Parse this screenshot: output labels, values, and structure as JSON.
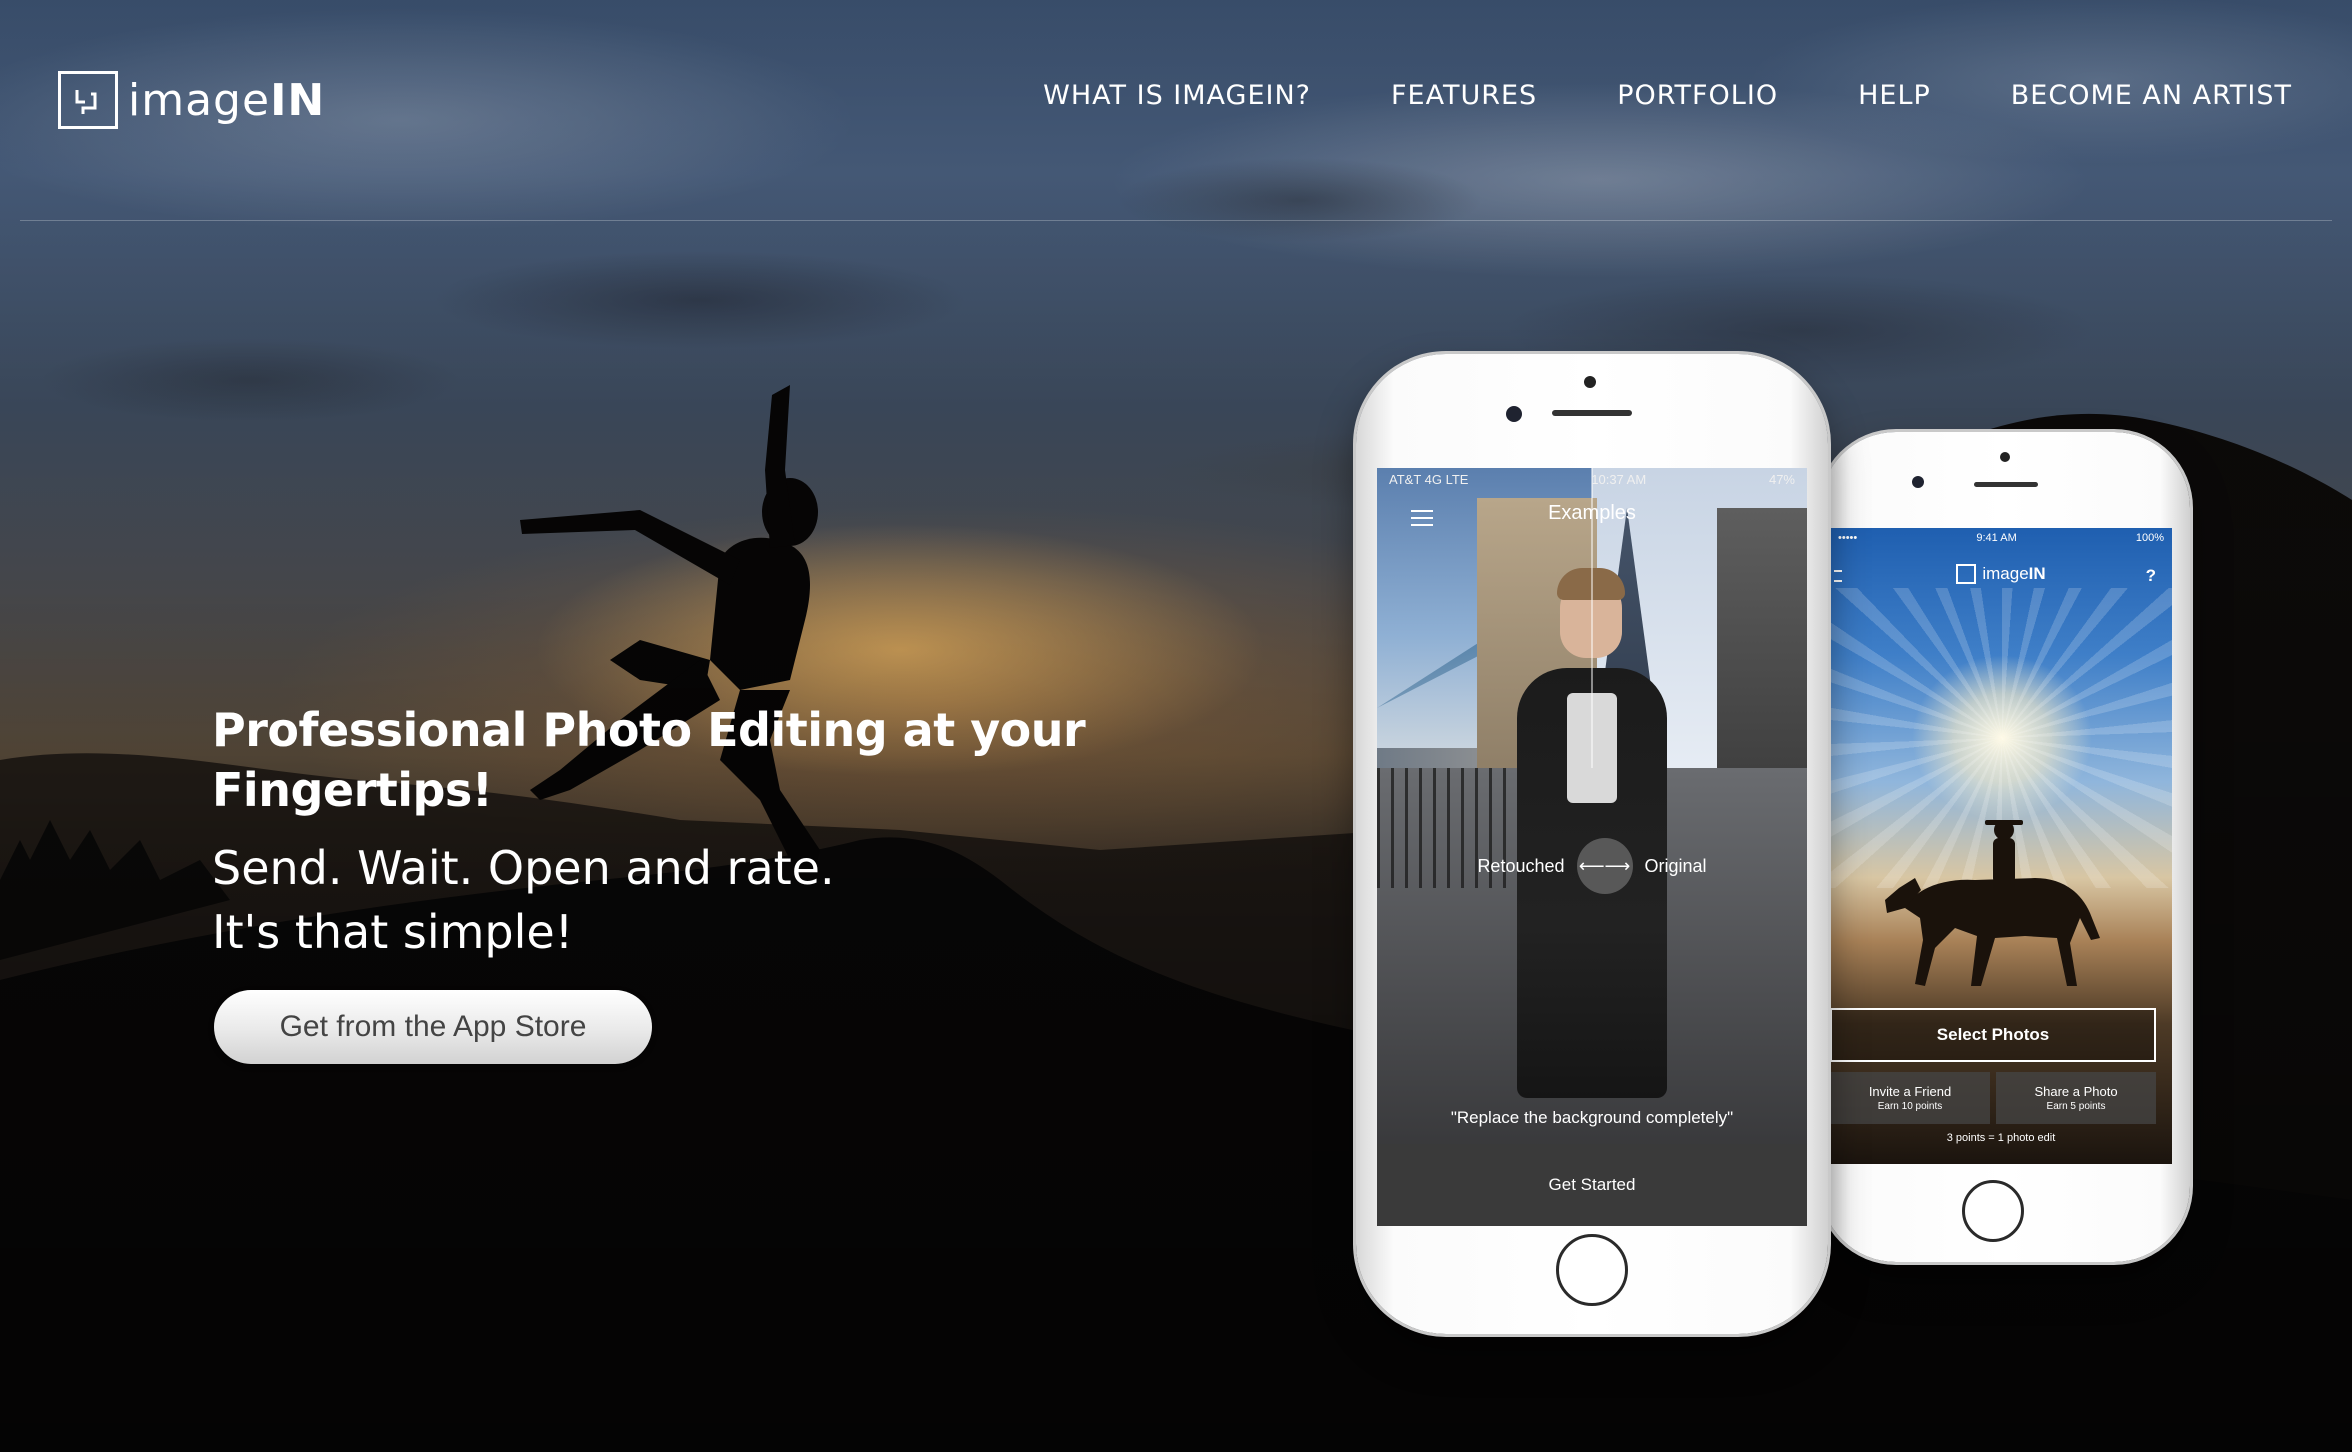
{
  "brand": {
    "name_light": "image",
    "name_bold": "IN"
  },
  "nav": {
    "items": [
      {
        "label": "WHAT IS IMAGEIN?"
      },
      {
        "label": "FEATURES"
      },
      {
        "label": "PORTFOLIO"
      },
      {
        "label": "HELP"
      },
      {
        "label": "BECOME AN ARTIST"
      }
    ]
  },
  "hero": {
    "title": "Professional Photo Editing at your Fingertips!",
    "subtitle_line1": "Send. Wait. Open and rate.",
    "subtitle_line2": "It's that simple!",
    "cta_label": "Get from the App Store"
  },
  "phone_left": {
    "status_carrier": "AT&T 4G  LTE",
    "status_time": "10:37 AM",
    "status_battery": "47%",
    "screen_title": "Examples",
    "compare_left": "Retouched",
    "compare_arrows": "⟵⟶",
    "compare_right": "Original",
    "caption": "\"Replace the background completely\"",
    "button_label": "Get Started"
  },
  "phone_right": {
    "status_signal": "•••••",
    "status_time": "9:41 AM",
    "status_battery": "100%",
    "logo_light": "image",
    "logo_bold": "IN",
    "help_label": "?",
    "select_label": "Select Photos",
    "actions": [
      {
        "title": "Invite a Friend",
        "sub": "Earn 10 points"
      },
      {
        "title": "Share a Photo",
        "sub": "Earn 5 points"
      }
    ],
    "note": "3 points = 1 photo edit"
  },
  "colors": {
    "text_primary": "#ffffff",
    "cta_text": "#444444",
    "phone_body": "#ffffff"
  }
}
